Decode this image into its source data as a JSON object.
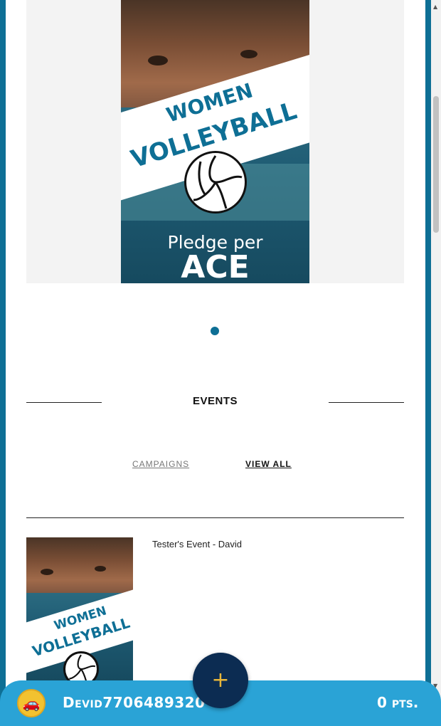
{
  "banner": {
    "line1": "WOMEN",
    "line2": "VOLLEYBALL",
    "pledge_line1": "Pledge per",
    "pledge_line2": "ACE",
    "carousel_index": 1,
    "carousel_total": 1
  },
  "section": {
    "title": "EVENTS"
  },
  "tabs": {
    "campaigns": "CAMPAIGNS",
    "view_all": "VIEW ALL"
  },
  "events": [
    {
      "title": "Tester's Event - David",
      "poster_line1": "WOMEN",
      "poster_line2": "VOLLEYBALL"
    }
  ],
  "footer": {
    "avatar_icon": "car-icon",
    "username": "Devid7706489320",
    "points": "0 pts."
  },
  "fab": {
    "icon": "plus-icon",
    "label": "+"
  },
  "colors": {
    "brand_dark": "#0e6f95",
    "footer": "#2aa3d6",
    "fab": "#0c2c52",
    "fab_icon": "#e8b63a"
  }
}
